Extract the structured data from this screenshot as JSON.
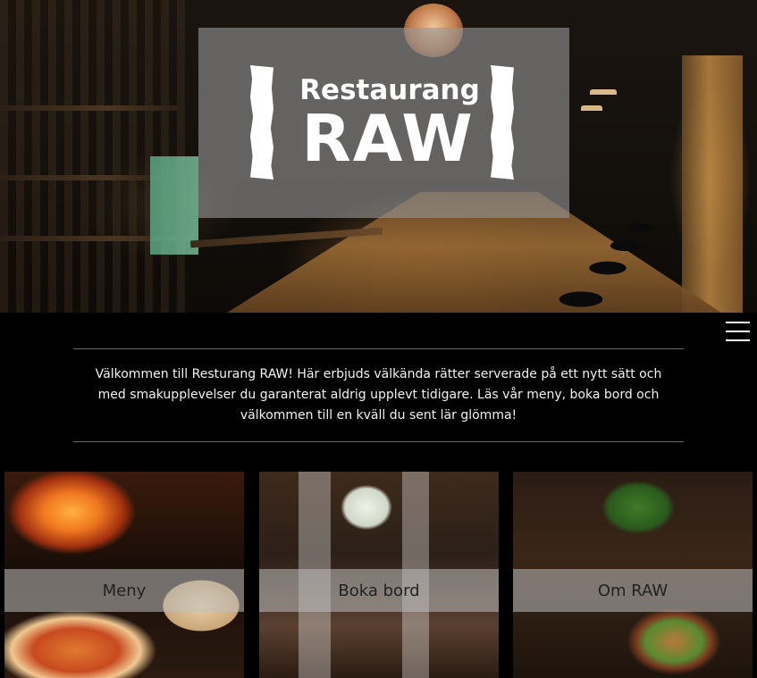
{
  "hero": {
    "logo_top": "Restaurang",
    "logo_main": "RAW"
  },
  "menu": {
    "icon": "hamburger-menu-icon"
  },
  "intro": {
    "text": "Välkommen till Resturang RAW! Här erbjuds välkända rätter serverade på ett nytt sätt och med smakupplevelser du garanterat aldrig upplevt tidigare. Läs vår meny, boka bord och välkommen till en kväll du sent lär glömma!"
  },
  "cards": [
    {
      "label": "Meny"
    },
    {
      "label": "Boka bord"
    },
    {
      "label": "Om RAW"
    }
  ]
}
